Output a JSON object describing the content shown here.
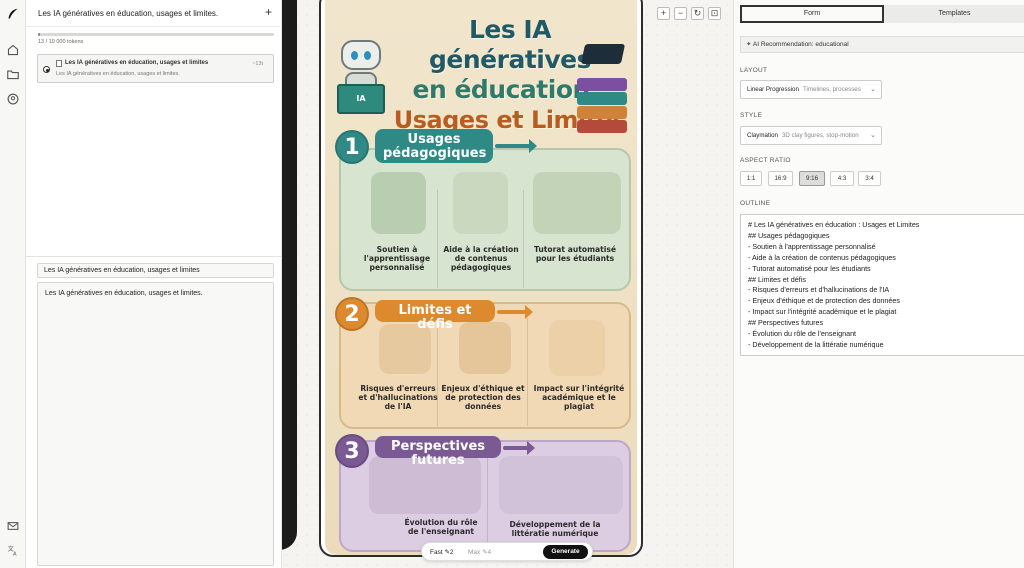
{
  "rail": {
    "icons": [
      "feather-logo-icon",
      "home-icon",
      "folder-icon",
      "user-circle-icon",
      "mail-icon",
      "translate-icon"
    ]
  },
  "chat": {
    "title": "Les IA génératives en éducation, usages et limites.",
    "add_label": "+",
    "tokens": "13 / 10 000 tokens",
    "tokens_progress": 0.0013,
    "conversation": {
      "name": "Les IA génératives en éducation, usages et limites",
      "time": "~13t",
      "preview": "Les IA génératives en éducation, usages et limites."
    },
    "prompt_title": "Les IA génératives en éducation, usages et limites",
    "prompt_body": "Les IA génératives en éducation, usages et limites."
  },
  "canvas": {
    "controls": [
      "+",
      "−",
      "↻",
      "⊡"
    ],
    "poster": {
      "title_line1": "Les IA génératives",
      "title_line2": "en éducation :",
      "title_line3": "Usages et Limites",
      "robot_book": "IA",
      "sections": [
        {
          "number": "1",
          "title": "Usages pédagogiques",
          "items": [
            "Soutien à l'apprentissage personnalisé",
            "Aide à la création de contenus pédagogiques",
            "Tutorat automatisé pour les étudiants"
          ]
        },
        {
          "number": "2",
          "title": "Limites et défis",
          "items": [
            "Risques d'erreurs et d'hallucinations de l'IA",
            "Enjeux d'éthique et de protection des données",
            "Impact sur l'intégrité académique et le plagiat"
          ]
        },
        {
          "number": "3",
          "title": "Perspectives futures",
          "items": [
            "Évolution du rôle de l'enseignant",
            "Développement de la littératie numérique"
          ]
        }
      ]
    },
    "gen_bar": {
      "fast_label": "Fast ✎2",
      "max_label": "Max ✎4",
      "generate_label": "Generate"
    }
  },
  "right": {
    "tabs": [
      "Form",
      "Templates"
    ],
    "ai_recommendation": "AI Recommendation: educational",
    "layout_label": "LAYOUT",
    "layout_value": "Linear Progression",
    "layout_desc": "Timelines, processes",
    "style_label": "STYLE",
    "style_value": "Claymation",
    "style_desc": "3D clay figures, stop-motion",
    "aspect_label": "ASPECT RATIO",
    "aspect_options": [
      "1:1",
      "16:9",
      "9:16",
      "4:3",
      "3:4"
    ],
    "aspect_selected": "9:16",
    "outline_label": "OUTLINE",
    "outline_text": "# Les IA génératives en éducation : Usages et Limites\n## Usages pédagogiques\n- Soutien à l'apprentissage personnalisé\n- Aide à la création de contenus pédagogiques\n- Tutorat automatisé pour les étudiants\n## Limites et défis\n- Risques d'erreurs et d'hallucinations de l'IA\n- Enjeux d'éthique et de protection des données\n- Impact sur l'intégrité académique et le plagiat\n## Perspectives futures\n- Évolution du rôle de l'enseignant\n- Développement de la littératie numérique"
  },
  "colors": {
    "teal": "#2f8a86",
    "orange": "#dd8a2e",
    "purple": "#7b5a94",
    "dark": "#111111"
  }
}
